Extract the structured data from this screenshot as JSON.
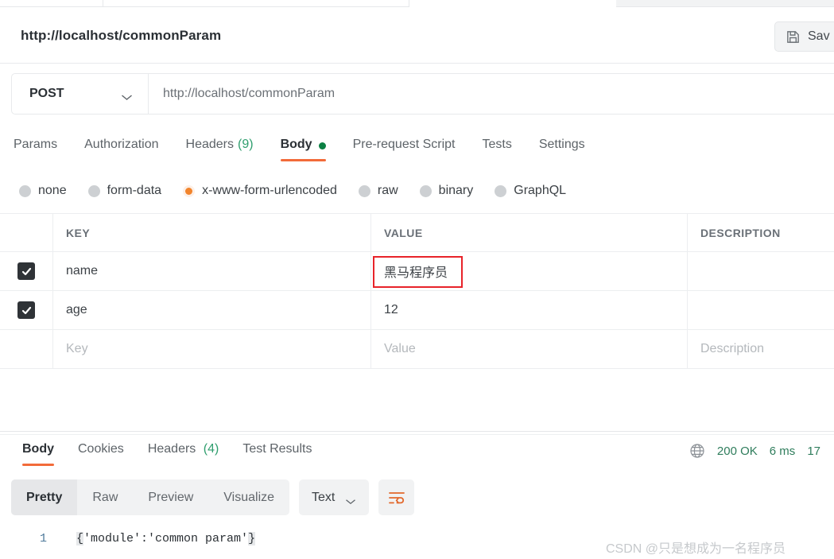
{
  "window": {
    "request_title": "http://localhost/commonParam",
    "save_label": "Sav",
    "save_icon": "save-disk-icon"
  },
  "url_bar": {
    "method": "POST",
    "method_chevron_icon": "chevron-down-icon",
    "url": "http://localhost/commonParam"
  },
  "request_tabs": [
    {
      "label": "Params",
      "count": "",
      "active": false,
      "dot": false
    },
    {
      "label": "Authorization",
      "count": "",
      "active": false,
      "dot": false
    },
    {
      "label": "Headers",
      "count": "(9)",
      "active": false,
      "dot": false
    },
    {
      "label": "Body",
      "count": "",
      "active": true,
      "dot": true
    },
    {
      "label": "Pre-request Script",
      "count": "",
      "active": false,
      "dot": false
    },
    {
      "label": "Tests",
      "count": "",
      "active": false,
      "dot": false
    },
    {
      "label": "Settings",
      "count": "",
      "active": false,
      "dot": false
    }
  ],
  "body_types": [
    {
      "label": "none",
      "selected": false
    },
    {
      "label": "form-data",
      "selected": false
    },
    {
      "label": "x-www-form-urlencoded",
      "selected": true
    },
    {
      "label": "raw",
      "selected": false
    },
    {
      "label": "binary",
      "selected": false
    },
    {
      "label": "GraphQL",
      "selected": false
    }
  ],
  "params_table": {
    "headers": [
      "KEY",
      "VALUE",
      "DESCRIPTION"
    ],
    "rows": [
      {
        "checked": true,
        "key": "name",
        "value": "黑马程序员",
        "description": "",
        "highlighted": true
      },
      {
        "checked": true,
        "key": "age",
        "value": "12",
        "description": "",
        "highlighted": false
      }
    ],
    "placeholder_row": {
      "key": "Key",
      "value": "Value",
      "description": "Description"
    }
  },
  "response_tabs": [
    {
      "label": "Body",
      "count": "",
      "active": true
    },
    {
      "label": "Cookies",
      "count": "",
      "active": false
    },
    {
      "label": "Headers",
      "count": "(4)",
      "active": false
    },
    {
      "label": "Test Results",
      "count": "",
      "active": false
    }
  ],
  "response_status": {
    "globe_icon": "globe-icon",
    "status": "200 OK",
    "time": "6 ms",
    "size": "17"
  },
  "response_toolbar": {
    "views": [
      {
        "label": "Pretty",
        "active": true
      },
      {
        "label": "Raw",
        "active": false
      },
      {
        "label": "Preview",
        "active": false
      },
      {
        "label": "Visualize",
        "active": false
      }
    ],
    "format": "Text",
    "format_chevron_icon": "chevron-down-icon",
    "wrap_icon": "word-wrap-icon"
  },
  "response_body": {
    "line_number": "1",
    "open_brace": "{",
    "content": "'module':'common param'",
    "close_brace": "}"
  },
  "watermark": "CSDN @只是想成为一名程序员",
  "colors": {
    "accent_orange": "#f26b3a",
    "status_green": "#2f7d5c",
    "count_green": "#2f9e6e",
    "annotation_red": "#e8232a",
    "body_dot_green": "#0b8043"
  }
}
